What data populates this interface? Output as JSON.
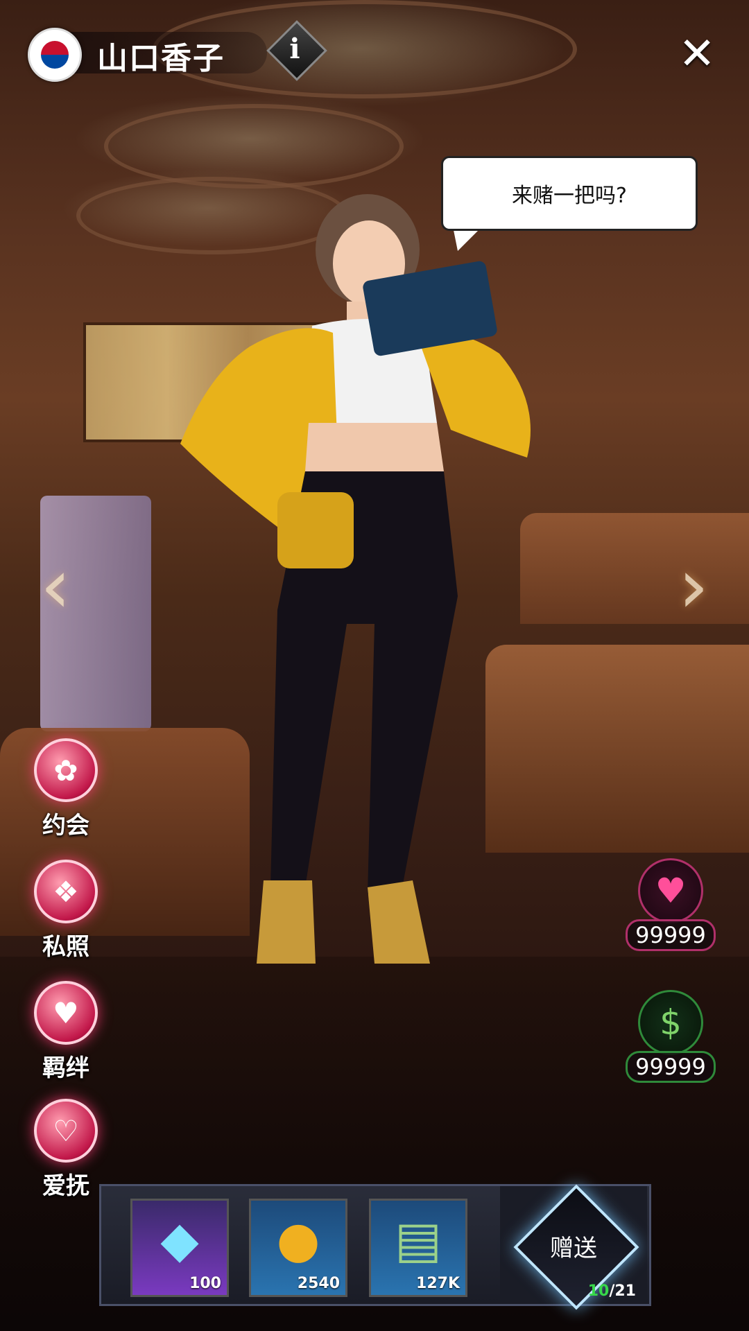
{
  "header": {
    "character_name": "山口香子",
    "flag_icon": "south-korea-flag-icon",
    "info_label": "i",
    "close_label": "✕"
  },
  "dialogue": {
    "text": "来赌一把吗?"
  },
  "nav": {
    "prev_label": "‹",
    "next_label": "›"
  },
  "menu": {
    "items": [
      {
        "label": "约会",
        "icon": "rose-icon"
      },
      {
        "label": "私照",
        "icon": "photo-card-icon"
      },
      {
        "label": "羁绊",
        "icon": "heart-lock-icon"
      },
      {
        "label": "爱抚",
        "icon": "heart-hand-icon"
      }
    ]
  },
  "stats": {
    "affection": {
      "value": "99999",
      "icon": "heart-icon",
      "color": "#ff4f9a"
    },
    "cash": {
      "value": "99999",
      "icon": "cash-clock-icon",
      "color": "#2f8a3a"
    }
  },
  "gifts": {
    "items": [
      {
        "icon": "diamond-icon",
        "count": "100"
      },
      {
        "icon": "gold-coin-icon",
        "count": "2540"
      },
      {
        "icon": "cash-stack-icon",
        "count": "127K"
      }
    ],
    "send_label": "赠送",
    "send_current": "10",
    "send_total": "/21"
  }
}
